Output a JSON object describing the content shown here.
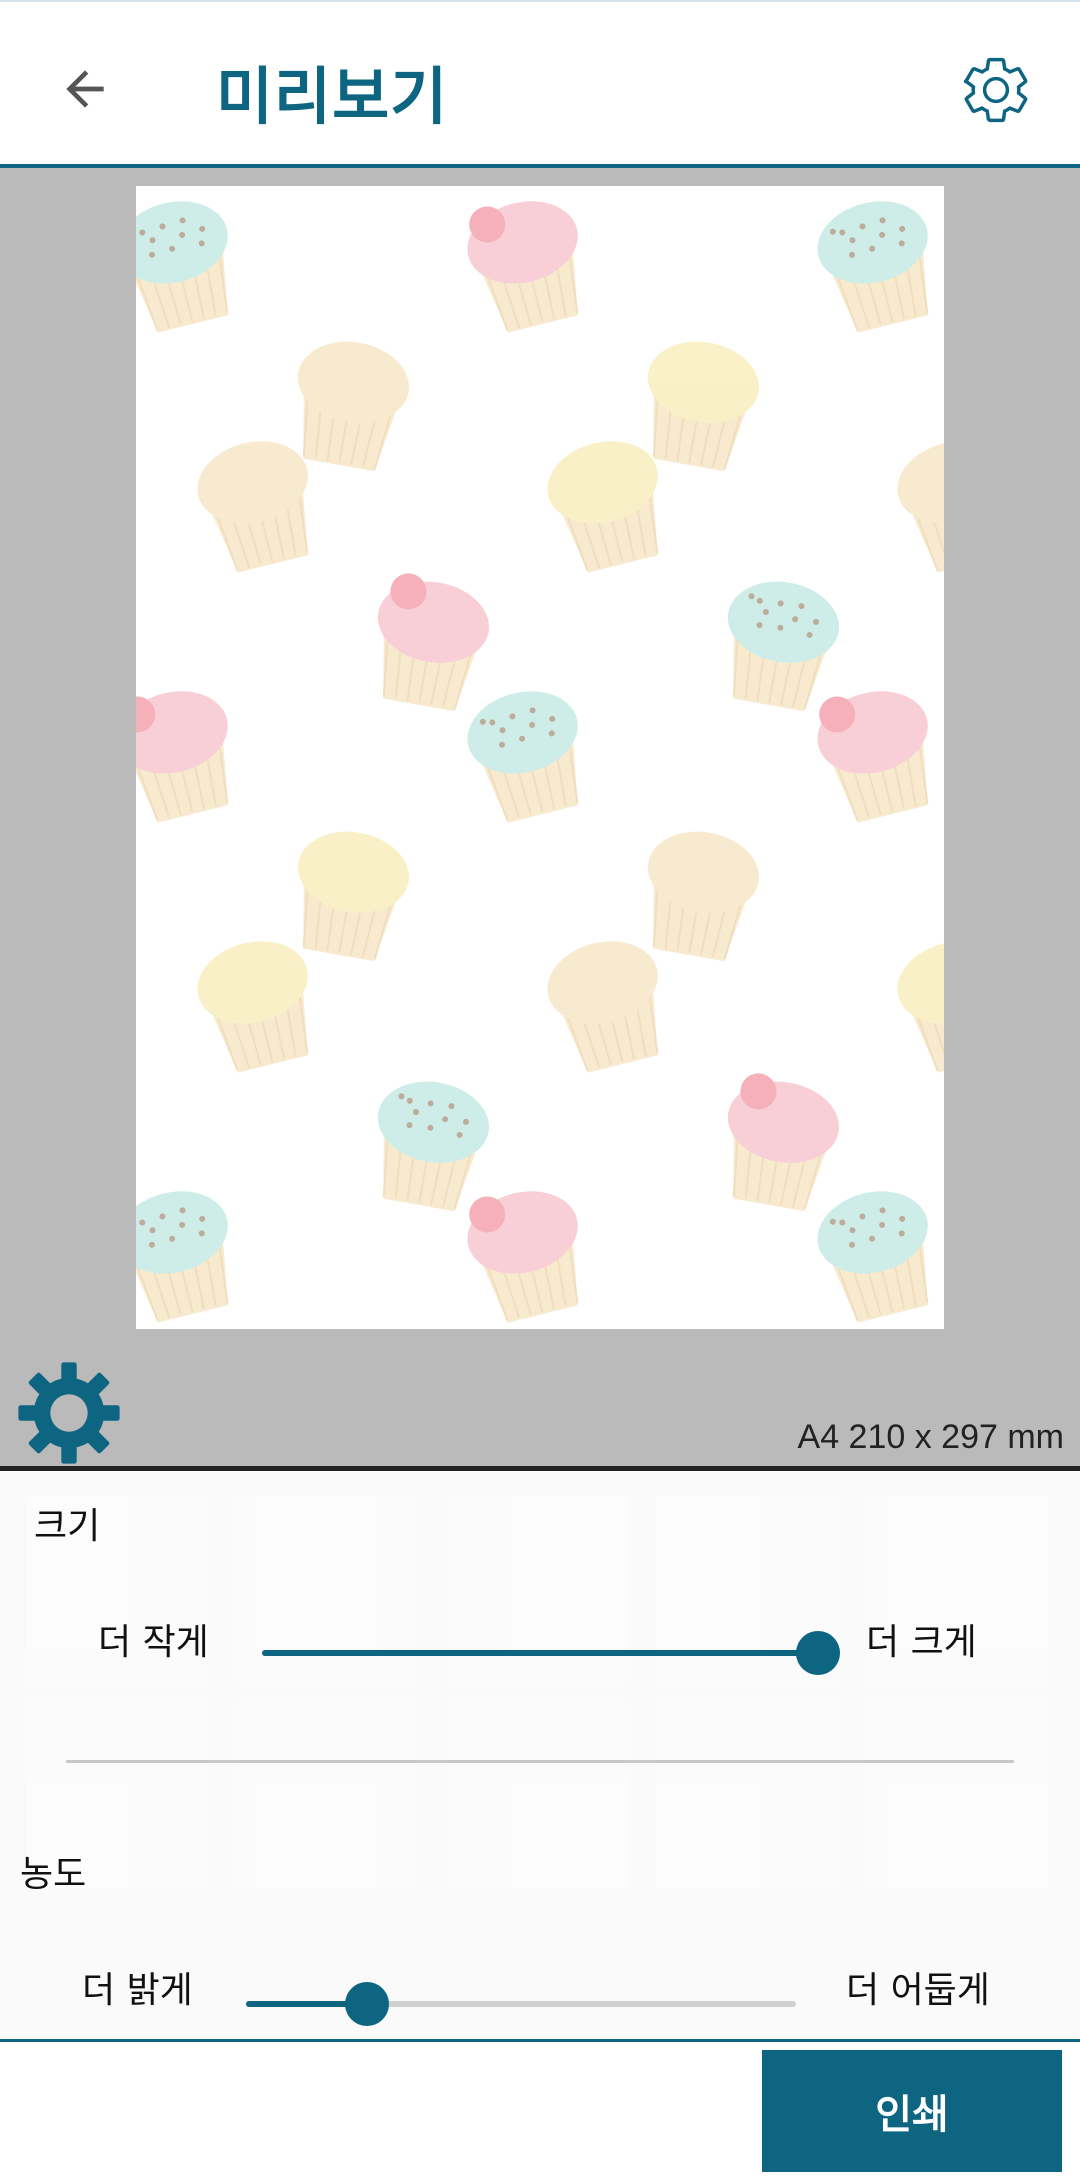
{
  "header": {
    "title": "미리보기",
    "back_icon": "arrow-left-icon",
    "settings_icon": "gear-outline-icon"
  },
  "preview": {
    "pattern": "cupcake-pattern",
    "paper_size": "A4 210 x 297 mm",
    "settings_icon": "gear-icon"
  },
  "controls": {
    "size": {
      "label": "크기",
      "min_label": "더 작게",
      "max_label": "더 크게",
      "value_fraction": 1.0
    },
    "density": {
      "label": "농도",
      "min_label": "더 밝게",
      "max_label": "더 어둡게",
      "value_fraction": 0.22
    }
  },
  "actions": {
    "print_label": "인쇄"
  },
  "colors": {
    "accent": "#0d6582",
    "preview_bg": "#bababa",
    "pink": "#f4a9b8",
    "mint": "#a7e0d6",
    "butter": "#f5e59a",
    "cake": "#f3d9a8"
  }
}
